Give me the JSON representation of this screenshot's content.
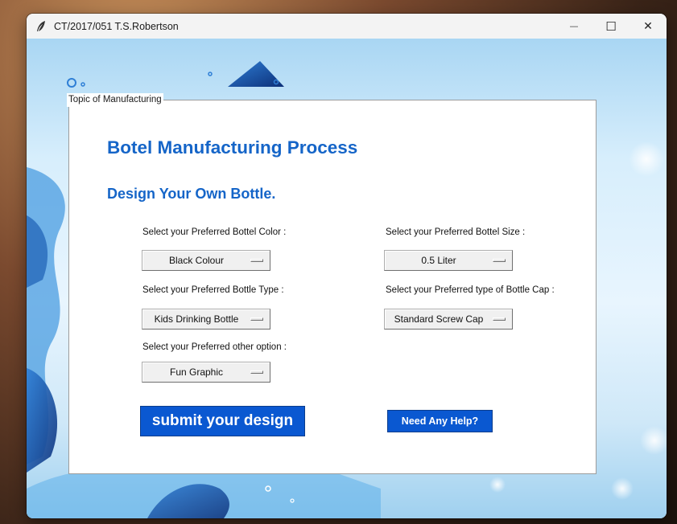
{
  "window": {
    "title": "CT/2017/051 T.S.Robertson",
    "minimize_glyph": "—",
    "maximize_glyph": "☐",
    "close_glyph": "✕"
  },
  "frame": {
    "legend": "Topic of Manufacturing"
  },
  "headings": {
    "title": "Botel Manufacturing Process",
    "subtitle": "Design Your Own Bottle."
  },
  "options": {
    "color": {
      "label": "Select your Preferred Bottel Color :",
      "value": "Black Colour"
    },
    "size": {
      "label": "Select your Preferred Bottel Size :",
      "value": "0.5 Liter"
    },
    "type": {
      "label": "Select your Preferred Bottle Type :",
      "value": "Kids Drinking Bottle"
    },
    "cap": {
      "label": "Select your Preferred type of Bottle Cap :",
      "value": "Standard Screw Cap"
    },
    "other": {
      "label": "Select your Preferred other option :",
      "value": "Fun Graphic"
    }
  },
  "buttons": {
    "submit": "submit your design",
    "help": "Need Any Help?"
  },
  "colors": {
    "accent": "#0a58d1",
    "heading": "#1565c8"
  },
  "icons": {
    "app": "feather-icon"
  }
}
